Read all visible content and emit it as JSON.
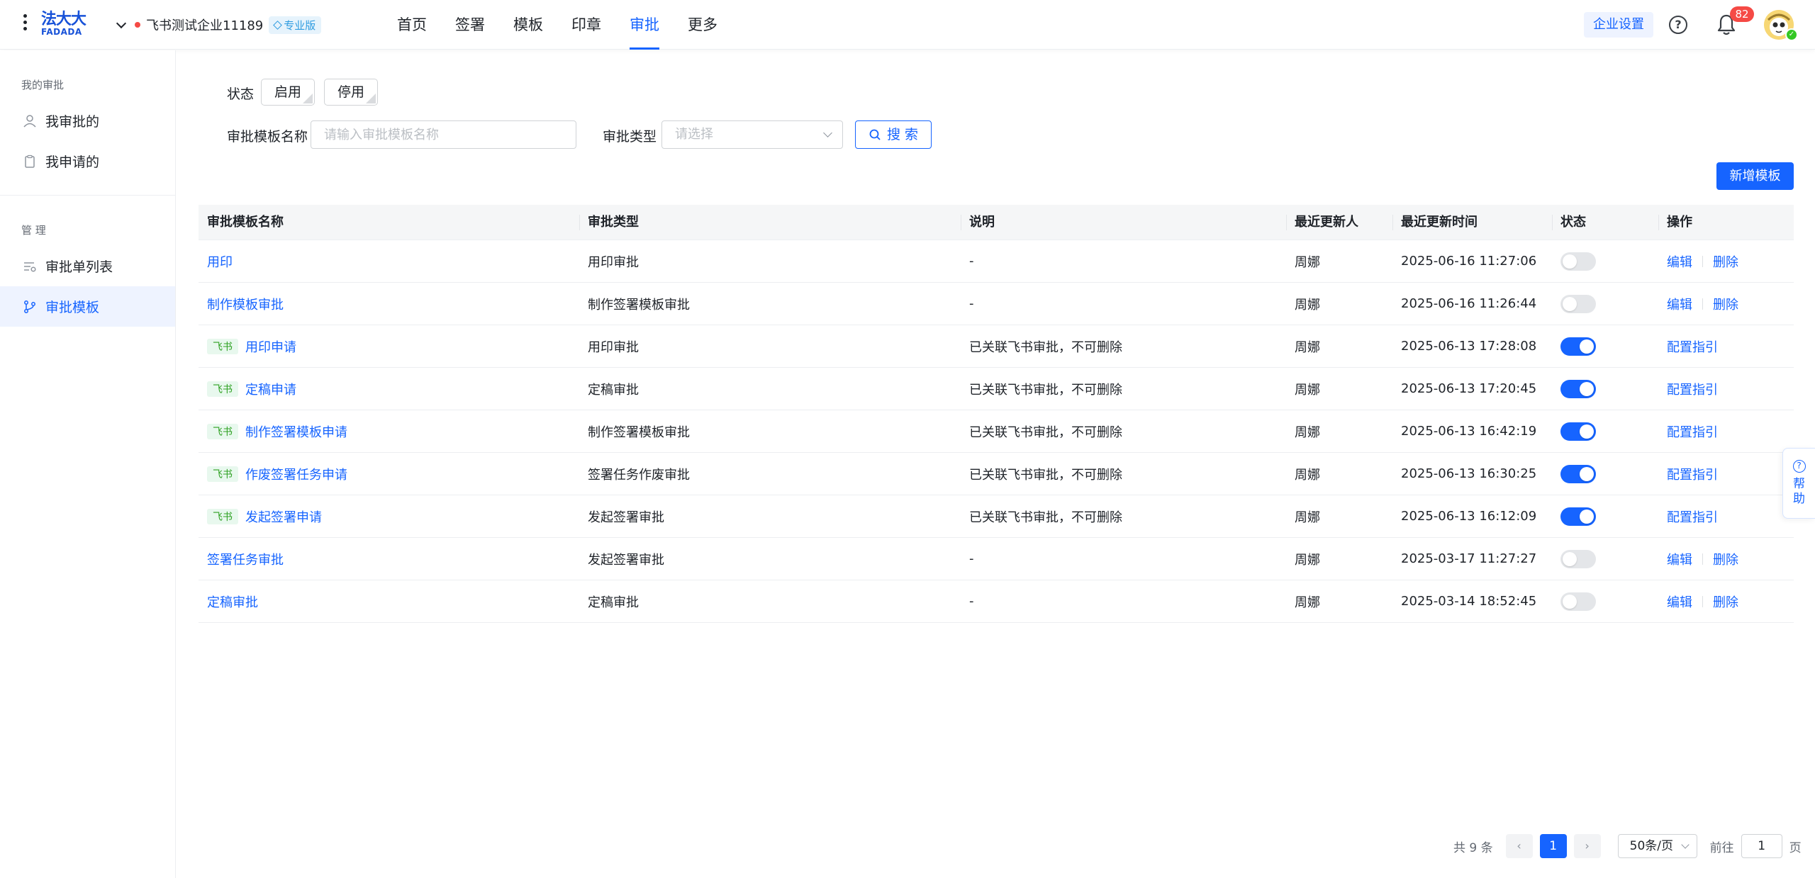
{
  "header": {
    "logo_cn": "法大大",
    "logo_en": "FADADA",
    "company": "飞书测试企业11189",
    "edition": "专业版",
    "nav": [
      "首页",
      "签署",
      "模板",
      "印章",
      "审批",
      "更多"
    ],
    "active_nav": "审批",
    "settings_label": "企业设置",
    "notification_count": "82",
    "colors": {
      "primary": "#1664ff",
      "badge": "#f54a45"
    }
  },
  "sidebar": {
    "group_my": "我的审批",
    "my_items": [
      "我审批的",
      "我申请的"
    ],
    "group_manage": "管 理",
    "manage_items": [
      "审批单列表",
      "审批模板"
    ],
    "active_item": "审批模板"
  },
  "filters": {
    "status_label": "状态",
    "status_enable": "启用",
    "status_disable": "停用",
    "name_label": "审批模板名称",
    "name_placeholder": "请输入审批模板名称",
    "type_label": "审批类型",
    "type_placeholder": "请选择",
    "search_label": "搜 索"
  },
  "add_button": "新增模板",
  "table": {
    "columns": [
      "审批模板名称",
      "审批类型",
      "说明",
      "最近更新人",
      "最近更新时间",
      "状态",
      "操作"
    ],
    "feishu_tag": "飞书",
    "op_edit": "编辑",
    "op_delete": "删除",
    "op_guide": "配置指引",
    "rows": [
      {
        "name": "用印",
        "feishu": false,
        "type": "用印审批",
        "desc": "-",
        "updater": "周娜",
        "time": "2025-06-16 11:27:06",
        "enabled": false
      },
      {
        "name": "制作模板审批",
        "feishu": false,
        "type": "制作签署模板审批",
        "desc": "-",
        "updater": "周娜",
        "time": "2025-06-16 11:26:44",
        "enabled": false
      },
      {
        "name": "用印申请",
        "feishu": true,
        "type": "用印审批",
        "desc": "已关联飞书审批，不可删除",
        "updater": "周娜",
        "time": "2025-06-13 17:28:08",
        "enabled": true
      },
      {
        "name": "定稿申请",
        "feishu": true,
        "type": "定稿审批",
        "desc": "已关联飞书审批，不可删除",
        "updater": "周娜",
        "time": "2025-06-13 17:20:45",
        "enabled": true
      },
      {
        "name": "制作签署模板申请",
        "feishu": true,
        "type": "制作签署模板审批",
        "desc": "已关联飞书审批，不可删除",
        "updater": "周娜",
        "time": "2025-06-13 16:42:19",
        "enabled": true
      },
      {
        "name": "作废签署任务申请",
        "feishu": true,
        "type": "签署任务作废审批",
        "desc": "已关联飞书审批，不可删除",
        "updater": "周娜",
        "time": "2025-06-13 16:30:25",
        "enabled": true
      },
      {
        "name": "发起签署申请",
        "feishu": true,
        "type": "发起签署审批",
        "desc": "已关联飞书审批，不可删除",
        "updater": "周娜",
        "time": "2025-06-13 16:12:09",
        "enabled": true
      },
      {
        "name": "签署任务审批",
        "feishu": false,
        "type": "发起签署审批",
        "desc": "-",
        "updater": "周娜",
        "time": "2025-03-17 11:27:27",
        "enabled": false
      },
      {
        "name": "定稿审批",
        "feishu": false,
        "type": "定稿审批",
        "desc": "-",
        "updater": "周娜",
        "time": "2025-03-14 18:52:45",
        "enabled": false
      }
    ]
  },
  "float_help": "帮助",
  "pagination": {
    "total_text": "共 9 条",
    "current_page": "1",
    "page_size": "50条/页",
    "goto_label": "前往",
    "goto_value": "1",
    "page_unit": "页"
  }
}
